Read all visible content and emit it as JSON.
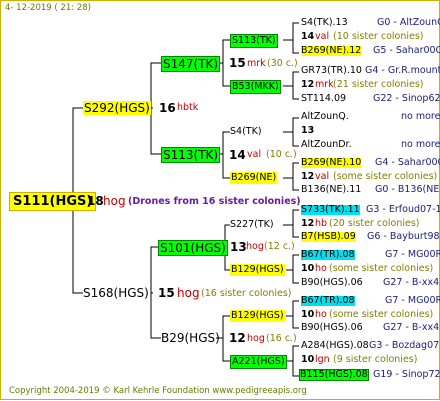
{
  "header": {
    "date": "4- 12-2019 ( 21: 28)"
  },
  "root": {
    "label": "S111(HGS)",
    "num": "18",
    "dim": "hog",
    "note": "(Drones from 16 sister colonies)"
  },
  "gen1": [
    {
      "label": "S292(HGS)",
      "num": "16",
      "dim": "hbtk"
    },
    {
      "label": "S168(HGS)",
      "num": "15",
      "dim": "hog",
      "note": "(16 sister colonies)"
    }
  ],
  "gen2": [
    {
      "label": "S147(TK)",
      "num": "15",
      "dim": "mrk",
      "note": "(30 c.)"
    },
    {
      "label": "S113(TK)",
      "num": "14",
      "dim": "val",
      "note": "(10 c.)"
    },
    {
      "label": "S101(HGS)",
      "num": "13",
      "dim": "hog",
      "note": "(12 c.)"
    },
    {
      "label": "B29(HGS)",
      "num": "12",
      "dim": "hog",
      "note": "(16 c.)"
    }
  ],
  "gen3": [
    {
      "label": "S113(TK)"
    },
    {
      "label": "B53(MKK)"
    },
    {
      "label": "S4(TK)"
    },
    {
      "label": "B269(NE)"
    },
    {
      "label": "S227(TK)"
    },
    {
      "label": "B129(HGS)"
    },
    {
      "label": "B129(HGS)"
    },
    {
      "label": "A221(HGS)"
    }
  ],
  "gen4": [
    {
      "a": "S4(TK).13",
      "a_right": "G0 - AltZounQ",
      "n": "14",
      "d": "val",
      "note": "(10 sister colonies)",
      "b": "B269(NE).12",
      "b_right": "G5 - Sahar00Q"
    },
    {
      "a": "GR73(TR).10",
      "a_right": "G4 - Gr.R.mounta",
      "n": "12",
      "d": "mrk",
      "note": "(21 sister colonies)",
      "b": "ST114.09",
      "b_right": "G22 - Sinop62R"
    },
    {
      "a": "AltZounQ.",
      "a_right": "no more",
      "n": "13",
      "d": "",
      "note": "",
      "b": "AltZounDr.",
      "b_right": "no more"
    },
    {
      "a": "B269(NE).10",
      "a_right": "G4 - Sahar00Q",
      "n": "12",
      "d": "val",
      "note": "(some sister colonies)",
      "b": "B136(NE).11",
      "b_right": "G0 - B136(NE)"
    },
    {
      "a": "S733(TK).11",
      "a_right": "G3 - Erfoud07-1Q",
      "n": "12",
      "d": "hb",
      "note": "(20 sister colonies)",
      "b": "B7(HSB).09",
      "b_right": "G6 - Bayburt98-3"
    },
    {
      "a": "B67(TR).08",
      "a_right": "G7 - MG00R",
      "n": "10",
      "d": "ho",
      "note": "(some sister colonies)",
      "b": "B90(HGS).06",
      "b_right": "G27 - B-xx43"
    },
    {
      "a": "B67(TR).08",
      "a_right": "G7 - MG00R",
      "n": "10",
      "d": "ho",
      "note": "(some sister colonies)",
      "b": "B90(HGS).06",
      "b_right": "G27 - B-xx43"
    },
    {
      "a": "A284(HGS).08",
      "a_right": "G3 - Bozdag07R",
      "n": "10",
      "d": "lgn",
      "note": "(9 sister colonies)",
      "b": "B115(HGS).08",
      "b_right": "G19 - Sinop72R"
    }
  ],
  "footer": {
    "text": "Copyright 2004-2019 © Karl Kehrle Foundation     www.pedigreeapis.org"
  }
}
